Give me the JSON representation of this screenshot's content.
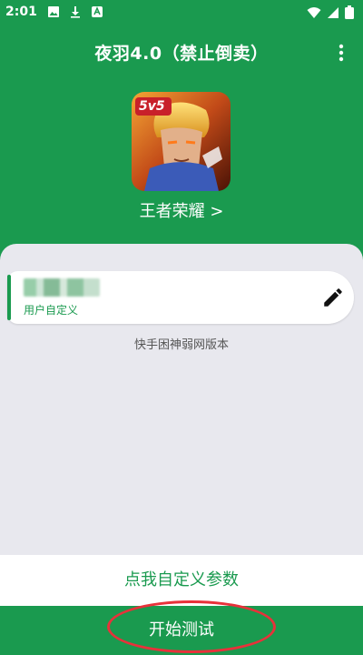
{
  "status": {
    "time": "2:01",
    "icons": [
      "image-icon",
      "download-icon",
      "app-icon"
    ]
  },
  "appbar": {
    "title": "夜羽4.0（禁止倒卖）"
  },
  "game": {
    "name": "王者荣耀 >",
    "badge": "5v5"
  },
  "card": {
    "sublabel": "用户自定义"
  },
  "version": "快手困神弱网版本",
  "actions": {
    "custom": "点我自定义参数",
    "start": "开始测试"
  },
  "colors": {
    "primary": "#1a9a4f",
    "annotation": "#e8313a"
  }
}
